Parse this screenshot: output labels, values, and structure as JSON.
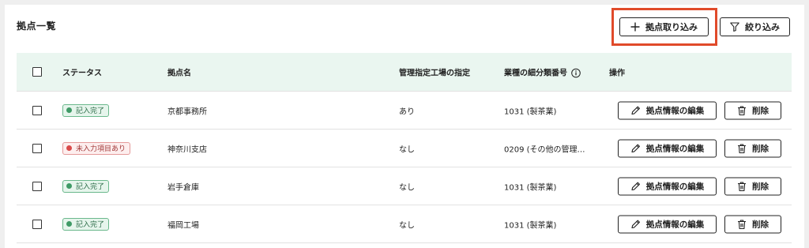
{
  "page": {
    "title": "拠点一覧"
  },
  "toolbar": {
    "import_label": "拠点取り込み",
    "filter_label": "絞り込み"
  },
  "table": {
    "headers": {
      "status": "ステータス",
      "name": "拠点名",
      "managed": "管理指定工場の指定",
      "industry": "業種の細分類番号",
      "operations": "操作"
    },
    "rows": [
      {
        "status": "記入完了",
        "status_type": "done",
        "name": "京都事務所",
        "managed": "あり",
        "industry": "1031 (製茶業)",
        "edit_label": "拠点情報の編集",
        "delete_label": "削除"
      },
      {
        "status": "未入力項目あり",
        "status_type": "todo",
        "name": "神奈川支店",
        "managed": "なし",
        "industry": "0209 (その他の管理…",
        "edit_label": "拠点情報の編集",
        "delete_label": "削除"
      },
      {
        "status": "記入完了",
        "status_type": "done",
        "name": "岩手倉庫",
        "managed": "なし",
        "industry": "1031 (製茶業)",
        "edit_label": "拠点情報の編集",
        "delete_label": "削除"
      },
      {
        "status": "記入完了",
        "status_type": "done",
        "name": "福岡工場",
        "managed": "なし",
        "industry": "1031 (製茶業)",
        "edit_label": "拠点情報の編集",
        "delete_label": "削除"
      }
    ]
  },
  "colors": {
    "highlight": "#e04a2a",
    "header_bg": "#eaf6f0",
    "done": "#3f9a66",
    "todo": "#d94a4a"
  }
}
